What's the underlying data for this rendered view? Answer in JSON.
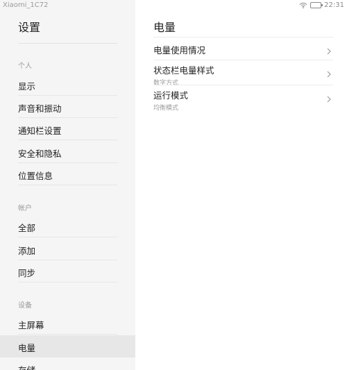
{
  "status_bar": {
    "device_name": "Xiaomi_1C72",
    "time": "22:31"
  },
  "sidebar": {
    "title": "设置",
    "sections": [
      {
        "label": "个人",
        "items": [
          "显示",
          "声音和振动",
          "通知栏设置",
          "安全和隐私",
          "位置信息"
        ]
      },
      {
        "label": "帐户",
        "items": [
          "全部",
          "添加",
          "同步"
        ]
      },
      {
        "label": "设备",
        "items": [
          "主屏幕",
          "电量",
          "存储"
        ]
      }
    ],
    "active_item": "电量"
  },
  "main": {
    "title": "电量",
    "items": [
      {
        "title": "电量使用情况",
        "subtitle": ""
      },
      {
        "title": "状态栏电量样式",
        "subtitle": "数字方式"
      },
      {
        "title": "运行模式",
        "subtitle": "均衡模式"
      }
    ]
  },
  "icons": {
    "wifi": "wifi-icon",
    "battery": "battery-icon",
    "chevron": "chevron-right-icon"
  }
}
